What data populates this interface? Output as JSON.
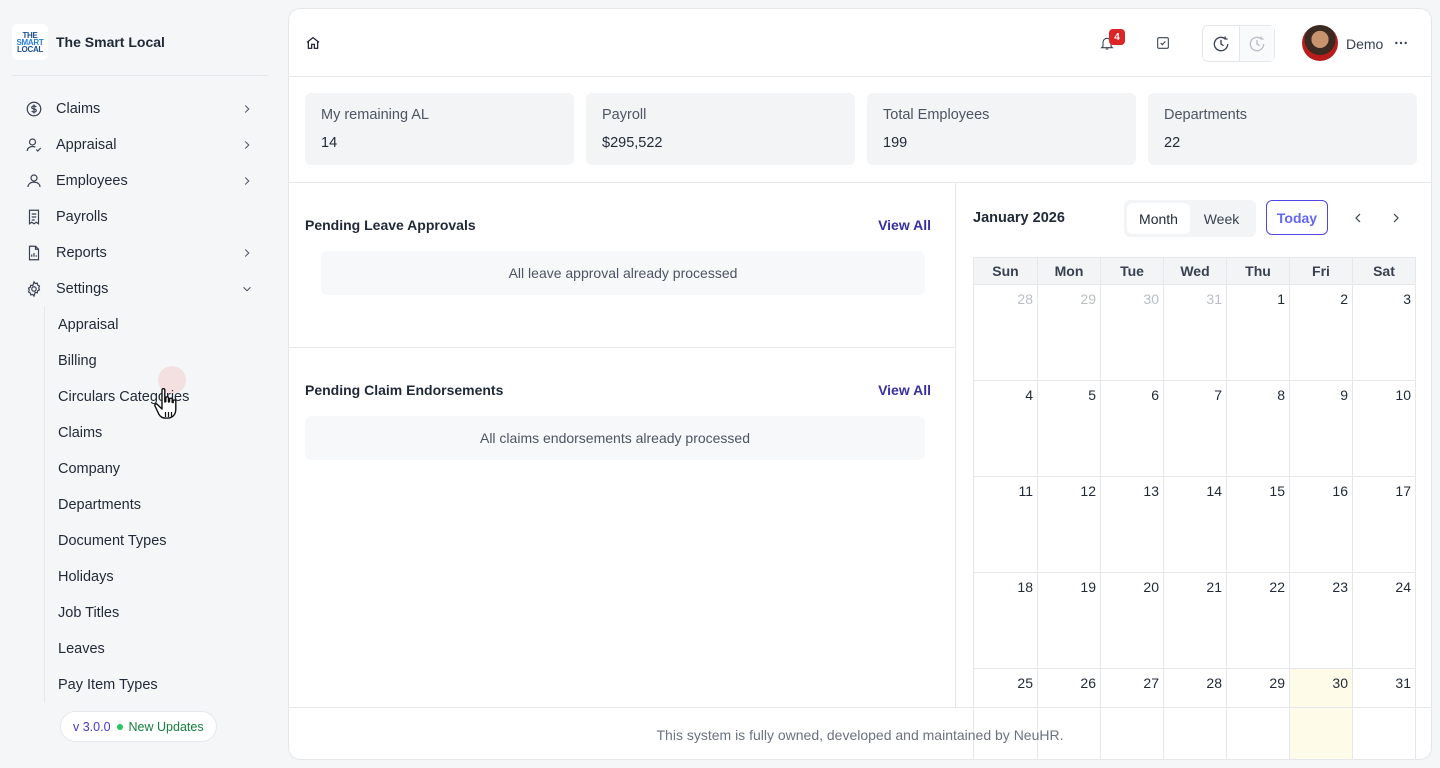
{
  "brand": {
    "name": "The Smart Local",
    "logo_lines": [
      "THE",
      "SMART",
      "LOCAL"
    ]
  },
  "sidebar": {
    "items": [
      {
        "label": "Claims",
        "icon": "dollar-circle-icon",
        "expandable": true,
        "expanded": false
      },
      {
        "label": "Appraisal",
        "icon": "user-check-icon",
        "expandable": true,
        "expanded": false
      },
      {
        "label": "Employees",
        "icon": "user-icon",
        "expandable": true,
        "expanded": false
      },
      {
        "label": "Payrolls",
        "icon": "receipt-icon",
        "expandable": false
      },
      {
        "label": "Reports",
        "icon": "report-icon",
        "expandable": true,
        "expanded": false
      },
      {
        "label": "Settings",
        "icon": "gear-icon",
        "expandable": true,
        "expanded": true
      }
    ],
    "settings_subitems": [
      "Appraisal",
      "Billing",
      "Circulars Categories",
      "Claims",
      "Company",
      "Departments",
      "Document Types",
      "Holidays",
      "Job Titles",
      "Leaves",
      "Pay Item Types"
    ],
    "version": "v 3.0.0",
    "update_label": "New Updates"
  },
  "header": {
    "notification_count": "4",
    "user_name": "Demo"
  },
  "stats": [
    {
      "label": "My remaining AL",
      "value": "14"
    },
    {
      "label": "Payroll",
      "value": "$295,522"
    },
    {
      "label": "Total Employees",
      "value": "199"
    },
    {
      "label": "Departments",
      "value": "22"
    }
  ],
  "leave": {
    "title": "Pending Leave Approvals",
    "view_all": "View All",
    "empty": "All leave approval already processed"
  },
  "claims": {
    "title": "Pending Claim Endorsements",
    "view_all": "View All",
    "empty": "All claims endorsements already processed"
  },
  "calendar": {
    "title": "January 2026",
    "views": [
      "Month",
      "Week"
    ],
    "active_view": "Month",
    "today_label": "Today",
    "weekdays": [
      "Sun",
      "Mon",
      "Tue",
      "Wed",
      "Thu",
      "Fri",
      "Sat"
    ],
    "weeks": [
      [
        "28",
        "29",
        "30",
        "31",
        "1",
        "2",
        "3"
      ],
      [
        "4",
        "5",
        "6",
        "7",
        "8",
        "9",
        "10"
      ],
      [
        "11",
        "12",
        "13",
        "14",
        "15",
        "16",
        "17"
      ],
      [
        "18",
        "19",
        "20",
        "21",
        "22",
        "23",
        "24"
      ],
      [
        "25",
        "26",
        "27",
        "28",
        "29",
        "30",
        "31"
      ]
    ],
    "muted_cells": [
      "0-0",
      "0-1",
      "0-2",
      "0-3"
    ],
    "today_cell": "4-5",
    "today_color": "#fefce8"
  },
  "footer": {
    "text": "This system is fully owned, developed and maintained by NeuHR."
  },
  "colors": {
    "accent": "#3730a3",
    "today_button": "#6366f1",
    "badge": "#dc2626",
    "update_dot": "#22c55e"
  }
}
